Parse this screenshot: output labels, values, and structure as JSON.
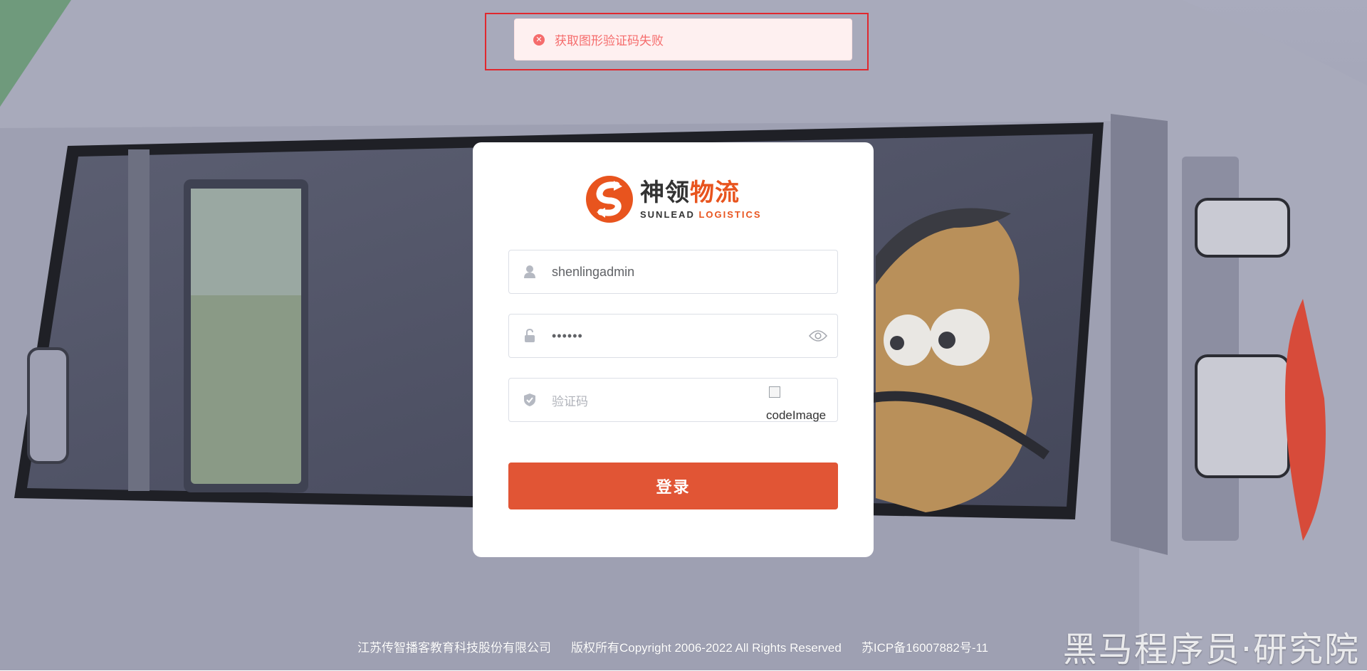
{
  "toast": {
    "message": "获取图形验证码失败",
    "icon": "error-circle-icon",
    "color": "#f56c6c"
  },
  "logo": {
    "name_dark": "神领",
    "name_red": "物流",
    "en_dark": "SUNLEAD ",
    "en_red": "LOGISTICS",
    "brand_color": "#e8541e"
  },
  "form": {
    "username_value": "shenlingadmin",
    "password_value": "••••••",
    "captcha_placeholder": "验证码",
    "captcha_image_alt": "codeImage",
    "login_label": "登录",
    "button_color": "#e15535"
  },
  "footer": {
    "company": "江苏传智播客教育科技股份有限公司",
    "copyright": "版权所有Copyright 2006-2022 All Rights Reserved",
    "icp": "苏ICP备16007882号-11"
  },
  "watermark": "黑马程序员·研究院"
}
